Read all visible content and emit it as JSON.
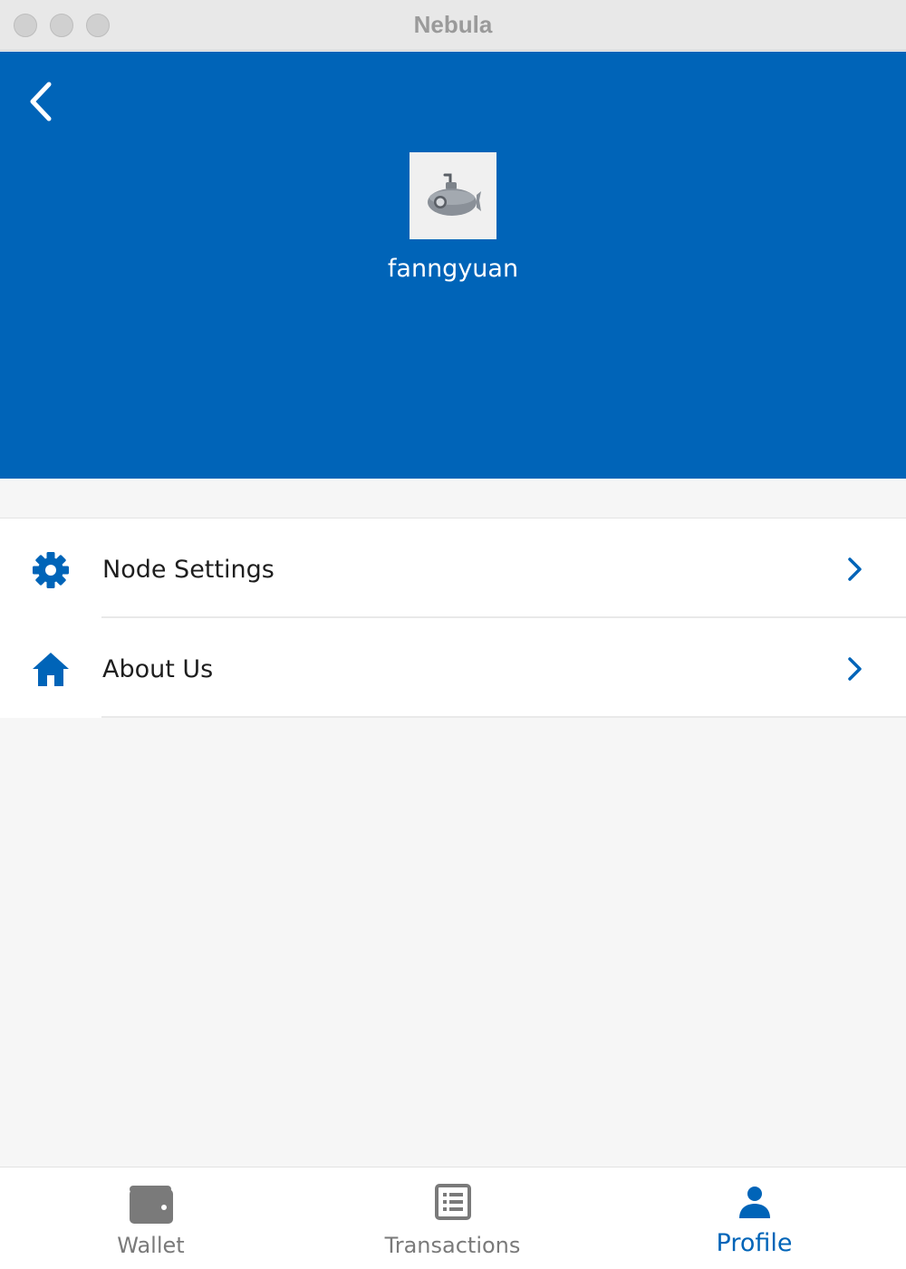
{
  "window": {
    "title": "Nebula"
  },
  "header": {
    "back_icon": "chevron-left-icon",
    "avatar_icon": "submarine-icon",
    "username": "fanngyuan",
    "background_color": "#0064b8"
  },
  "menu": {
    "items": [
      {
        "label": "Node Settings",
        "icon": "gear-icon"
      },
      {
        "label": "About Us",
        "icon": "home-icon"
      }
    ],
    "accent_color": "#0064b8"
  },
  "tabs": {
    "items": [
      {
        "label": "Wallet",
        "icon": "wallet-icon",
        "active": false
      },
      {
        "label": "Transactions",
        "icon": "list-icon",
        "active": false
      },
      {
        "label": "Profile",
        "icon": "person-icon",
        "active": true
      }
    ]
  }
}
